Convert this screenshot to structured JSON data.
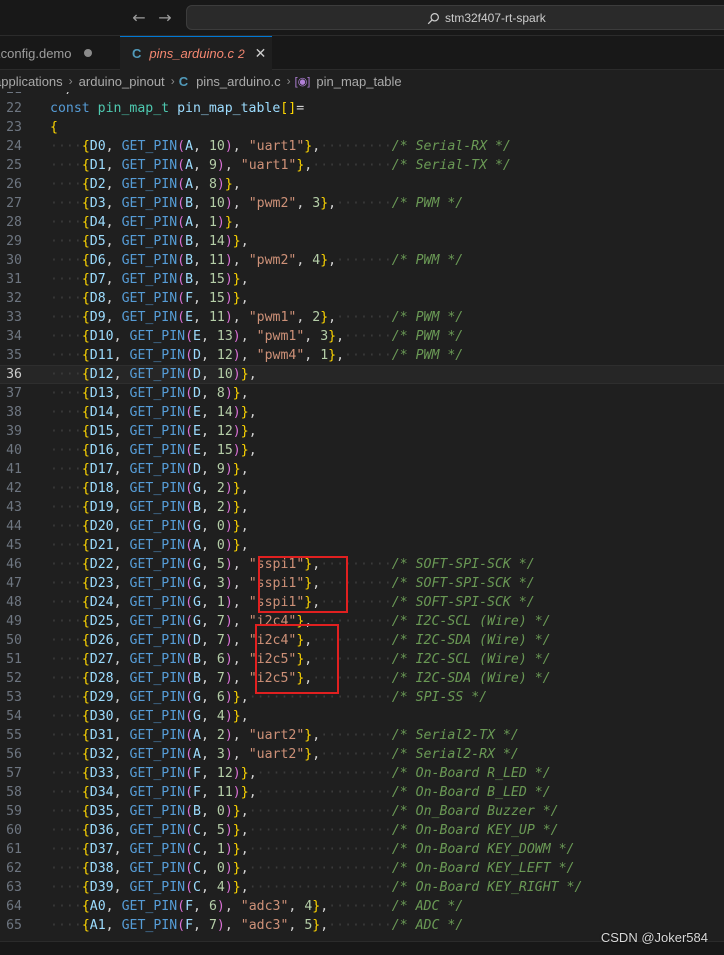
{
  "titlebar": {
    "back_icon": "arrow-left-icon",
    "forward_icon": "arrow-right-icon",
    "search_icon": "search-icon",
    "command_center_text": "stm32f407-rt-spark"
  },
  "tabs": [
    {
      "label": "Kconfig.demo",
      "modified": true
    },
    {
      "label": "pins_arduino.c",
      "language_badge": "C",
      "problems": "2",
      "close_icon": "close-icon"
    }
  ],
  "breadcrumb": {
    "items": [
      "applications",
      "arduino_pinout",
      "pins_arduino.c",
      "pin_map_table"
    ],
    "file_badge": "C"
  },
  "editor": {
    "current_line": "36",
    "colors": {
      "keyword": "#569cd6",
      "type": "#4ec9b0",
      "string": "#ce9178",
      "number": "#b5cea8",
      "comment": "#6a9955",
      "highlight_box": "#e02020"
    },
    "lines": [
      {
        "n": "21",
        "code": " */"
      },
      {
        "n": "22",
        "code": "const pin_map_t pin_map_table[]="
      },
      {
        "n": "23",
        "code": "{"
      },
      {
        "n": "24",
        "code": "    {D0, GET_PIN(A, 10), \"uart1\"},         /* Serial-RX */"
      },
      {
        "n": "25",
        "code": "    {D1, GET_PIN(A, 9), \"uart1\"},          /* Serial-TX */"
      },
      {
        "n": "26",
        "code": "    {D2, GET_PIN(A, 8)},"
      },
      {
        "n": "27",
        "code": "    {D3, GET_PIN(B, 10), \"pwm2\", 3},       /* PWM */"
      },
      {
        "n": "28",
        "code": "    {D4, GET_PIN(A, 1)},"
      },
      {
        "n": "29",
        "code": "    {D5, GET_PIN(B, 14)},"
      },
      {
        "n": "30",
        "code": "    {D6, GET_PIN(B, 11), \"pwm2\", 4},       /* PWM */"
      },
      {
        "n": "31",
        "code": "    {D7, GET_PIN(B, 15)},"
      },
      {
        "n": "32",
        "code": "    {D8, GET_PIN(F, 15)},"
      },
      {
        "n": "33",
        "code": "    {D9, GET_PIN(E, 11), \"pwm1\", 2},       /* PWM */"
      },
      {
        "n": "34",
        "code": "    {D10, GET_PIN(E, 13), \"pwm1\", 3},      /* PWM */"
      },
      {
        "n": "35",
        "code": "    {D11, GET_PIN(D, 12), \"pwm4\", 1},      /* PWM */"
      },
      {
        "n": "36",
        "code": "    {D12, GET_PIN(D, 10)},"
      },
      {
        "n": "37",
        "code": "    {D13, GET_PIN(D, 8)},"
      },
      {
        "n": "38",
        "code": "    {D14, GET_PIN(E, 14)},"
      },
      {
        "n": "39",
        "code": "    {D15, GET_PIN(E, 12)},"
      },
      {
        "n": "40",
        "code": "    {D16, GET_PIN(E, 15)},"
      },
      {
        "n": "41",
        "code": "    {D17, GET_PIN(D, 9)},"
      },
      {
        "n": "42",
        "code": "    {D18, GET_PIN(G, 2)},"
      },
      {
        "n": "43",
        "code": "    {D19, GET_PIN(B, 2)},"
      },
      {
        "n": "44",
        "code": "    {D20, GET_PIN(G, 0)},"
      },
      {
        "n": "45",
        "code": "    {D21, GET_PIN(A, 0)},"
      },
      {
        "n": "46",
        "code": "    {D22, GET_PIN(G, 5), \"sspi1\"},         /* SOFT-SPI-SCK */"
      },
      {
        "n": "47",
        "code": "    {D23, GET_PIN(G, 3), \"sspi1\"},         /* SOFT-SPI-SCK */"
      },
      {
        "n": "48",
        "code": "    {D24, GET_PIN(G, 1), \"sspi1\"},         /* SOFT-SPI-SCK */"
      },
      {
        "n": "49",
        "code": "    {D25, GET_PIN(G, 7), \"i2c4\"},          /* I2C-SCL (Wire) */"
      },
      {
        "n": "50",
        "code": "    {D26, GET_PIN(D, 7), \"i2c4\"},          /* I2C-SDA (Wire) */"
      },
      {
        "n": "51",
        "code": "    {D27, GET_PIN(B, 6), \"i2c5\"},          /* I2C-SCL (Wire) */"
      },
      {
        "n": "52",
        "code": "    {D28, GET_PIN(B, 7), \"i2c5\"},          /* I2C-SDA (Wire) */"
      },
      {
        "n": "53",
        "code": "    {D29, GET_PIN(G, 6)},                  /* SPI-SS */"
      },
      {
        "n": "54",
        "code": "    {D30, GET_PIN(G, 4)},"
      },
      {
        "n": "55",
        "code": "    {D31, GET_PIN(A, 2), \"uart2\"},         /* Serial2-TX */"
      },
      {
        "n": "56",
        "code": "    {D32, GET_PIN(A, 3), \"uart2\"},         /* Serial2-RX */"
      },
      {
        "n": "57",
        "code": "    {D33, GET_PIN(F, 12)},                 /* On-Board R_LED */"
      },
      {
        "n": "58",
        "code": "    {D34, GET_PIN(F, 11)},                 /* On-Board B_LED */"
      },
      {
        "n": "59",
        "code": "    {D35, GET_PIN(B, 0)},                  /* On_Board Buzzer */"
      },
      {
        "n": "60",
        "code": "    {D36, GET_PIN(C, 5)},                  /* On-Board KEY_UP */"
      },
      {
        "n": "61",
        "code": "    {D37, GET_PIN(C, 1)},                  /* On-Board KEY_DOWM */"
      },
      {
        "n": "62",
        "code": "    {D38, GET_PIN(C, 0)},                  /* On-Board KEY_LEFT */"
      },
      {
        "n": "63",
        "code": "    {D39, GET_PIN(C, 4)},                  /* On-Board KEY_RIGHT */"
      },
      {
        "n": "64",
        "code": "    {A0, GET_PIN(F, 6), \"adc3\", 4},        /* ADC */"
      },
      {
        "n": "65",
        "code": "    {A1, GET_PIN(F, 7), \"adc3\", 5},        /* ADC */"
      }
    ]
  },
  "watermark": "CSDN @Joker584"
}
